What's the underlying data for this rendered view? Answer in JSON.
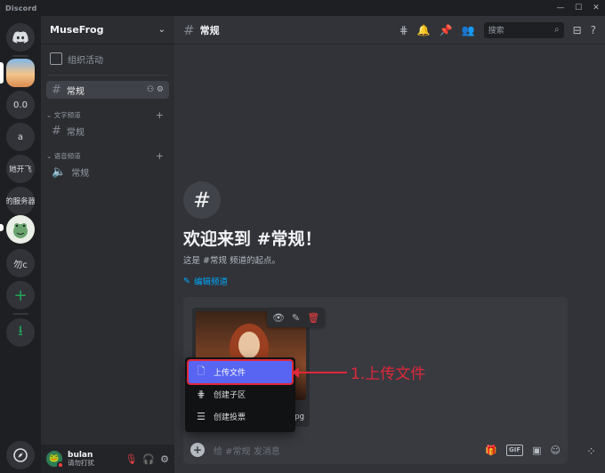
{
  "window": {
    "app_name": "Discord",
    "controls": [
      "—",
      "☐",
      "✕"
    ]
  },
  "servers": [
    {
      "label": "",
      "kind": "home"
    },
    {
      "label": "",
      "kind": "image"
    },
    {
      "label": "0.0"
    },
    {
      "label": "a"
    },
    {
      "label": "她开飞"
    },
    {
      "label": "的服务器"
    },
    {
      "label": "",
      "kind": "frog"
    },
    {
      "label": "勿c"
    },
    {
      "label": "+",
      "kind": "add"
    },
    {
      "label": "⭳",
      "kind": "download"
    },
    {
      "label": "",
      "kind": "discover"
    }
  ],
  "guild": {
    "name": "MuseFrog",
    "events_label": "组织活动",
    "active_channel": "常规",
    "text_category": "文字频道",
    "text_channel": "常规",
    "voice_category": "语音频道",
    "voice_channel": "常规"
  },
  "user": {
    "name": "bulan",
    "status": "请勿打扰"
  },
  "header": {
    "channel": "常规",
    "search_placeholder": "搜索"
  },
  "welcome": {
    "title": "欢迎来到 #常规！",
    "subtitle": "这是 #常规 频道的起点。",
    "edit_label": "编辑频道"
  },
  "attachment": {
    "filename": "pg"
  },
  "composer": {
    "placeholder": "给 #常规 发消息",
    "gif_label": "GIF"
  },
  "menu": {
    "items": [
      {
        "label": "上传文件",
        "icon": "upload-file-icon"
      },
      {
        "label": "创建子区",
        "icon": "thread-icon"
      },
      {
        "label": "创建投票",
        "icon": "poll-icon"
      }
    ]
  },
  "annotation": {
    "text": "1.上传文件",
    "color": "#e0283a"
  },
  "colors": {
    "blurple": "#5865f2",
    "danger": "#f23f43",
    "link": "#00a8fc",
    "online": "#23a559"
  }
}
